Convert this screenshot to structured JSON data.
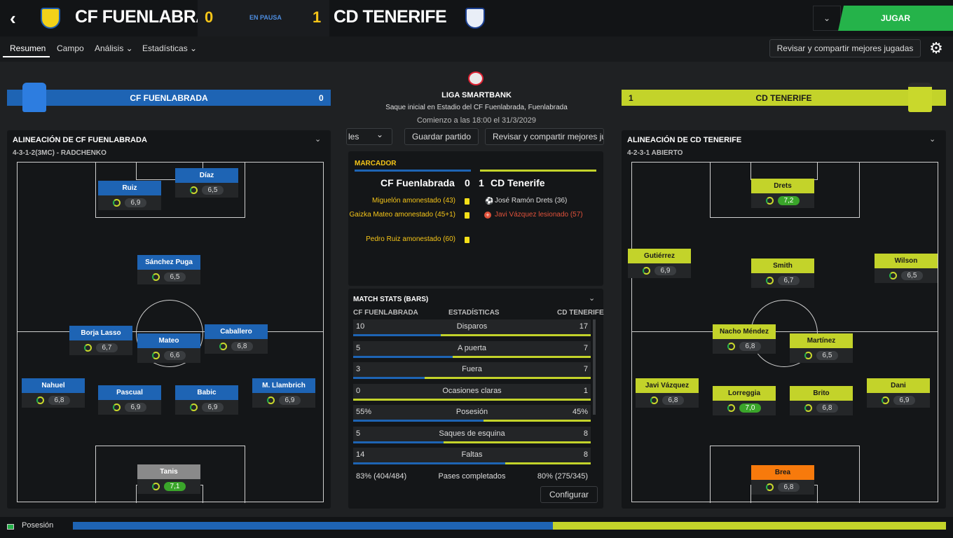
{
  "header": {
    "home_team": "CF FUENLABRADA",
    "away_team": "CD TENERIFE",
    "home_score": "0",
    "away_score": "1",
    "status": "EN PAUSA",
    "play_button": "JUGAR",
    "dropdown_icon": "chevron-down-icon"
  },
  "tabs": [
    {
      "label": "Resumen",
      "active": true
    },
    {
      "label": "Campo"
    },
    {
      "label": "Análisis ⌄"
    },
    {
      "label": "Estadísticas ⌄"
    }
  ],
  "review_button": "Revisar y compartir mejores jugadas",
  "home": {
    "banner_name": "CF FUENLABRADA",
    "banner_score": "0",
    "lineup_title": "ALINEACIÓN DE CF FUENLABRADA",
    "formation": "4-3-1-2(3MC) - RADCHENKO",
    "players": [
      {
        "name": "Díaz",
        "rating": "6,5"
      },
      {
        "name": "Ruiz",
        "rating": "6,9"
      },
      {
        "name": "Sánchez Puga",
        "rating": "6,5"
      },
      {
        "name": "Borja Lasso",
        "rating": "6,7"
      },
      {
        "name": "Mateo",
        "rating": "6,6"
      },
      {
        "name": "Caballero",
        "rating": "6,8"
      },
      {
        "name": "Nahuel",
        "rating": "6,8"
      },
      {
        "name": "Pascual",
        "rating": "6,9"
      },
      {
        "name": "Babic",
        "rating": "6,9"
      },
      {
        "name": "M. Llambrich",
        "rating": "6,9"
      },
      {
        "name": "Tanis",
        "rating": "7,1"
      }
    ]
  },
  "away": {
    "banner_name": "CD TENERIFE",
    "banner_score": "1",
    "lineup_title": "ALINEACIÓN DE CD TENERIFE",
    "formation": "4-2-3-1 ABIERTO",
    "players": [
      {
        "name": "Drets",
        "rating": "7,2"
      },
      {
        "name": "Gutiérrez",
        "rating": "6,9"
      },
      {
        "name": "Smith",
        "rating": "6,7"
      },
      {
        "name": "Wilson",
        "rating": "6,5"
      },
      {
        "name": "Nacho Méndez",
        "rating": "6,8"
      },
      {
        "name": "Martínez",
        "rating": "6,5"
      },
      {
        "name": "Javi Vázquez",
        "rating": "6,8"
      },
      {
        "name": "Lorreggia",
        "rating": "7,0"
      },
      {
        "name": "Brito",
        "rating": "6,8"
      },
      {
        "name": "Dani",
        "rating": "6,9"
      },
      {
        "name": "Brea",
        "rating": "6,8"
      }
    ]
  },
  "match": {
    "league": "LIGA SMARTBANK",
    "kickoff": "Saque inicial en Estadio del CF Fuenlabrada, Fuenlabrada",
    "start_time": "Comienzo a las 18:00 el 31/3/2029",
    "select_label": "les",
    "save_button": "Guardar partido",
    "review_button": "Revisar y compartir mejores ju"
  },
  "scoreboard": {
    "title": "MARCADOR",
    "line": "CF Fuenlabrada  0   1  CD Tenerife",
    "home_events": [
      "Miguelón amonestado (43)",
      "Gaizka Mateo amonestado (45+1)",
      "Pedro Ruiz amonestado (60)"
    ],
    "away_events": [
      {
        "text": "José Ramón Drets (36)",
        "icon": "ball-icon",
        "color": "#dddddd"
      },
      {
        "text": "Javi Vázquez lesionado (57)",
        "icon": "injury-icon",
        "color": "#e0513a"
      }
    ]
  },
  "stats": {
    "title": "MATCH STATS (BARS)",
    "col_home": "CF FUENLABRADA",
    "col_mid": "ESTADÍSTICAS",
    "col_away": "CD TENERIFE",
    "rows": [
      {
        "home": "10",
        "label": "Disparos",
        "away": "17",
        "share": 0.37
      },
      {
        "home": "5",
        "label": "A puerta",
        "away": "7",
        "share": 0.42
      },
      {
        "home": "3",
        "label": "Fuera",
        "away": "7",
        "share": 0.3
      },
      {
        "home": "0",
        "label": "Ocasiones claras",
        "away": "1",
        "share": 0.0
      },
      {
        "home": "55%",
        "label": "Posesión",
        "away": "45%",
        "share": 0.55
      },
      {
        "home": "5",
        "label": "Saques de esquina",
        "away": "8",
        "share": 0.38
      },
      {
        "home": "14",
        "label": "Faltas",
        "away": "8",
        "share": 0.64
      },
      {
        "home": "83% (404/484)",
        "label": "Pases completados",
        "away": "80% (275/345)",
        "share": null
      }
    ],
    "configure_button": "Configurar"
  },
  "possession": {
    "label": "Posesión",
    "home_share": 0.55
  },
  "colors": {
    "home": "#1e64b4",
    "away": "#c3d32a",
    "play": "#25b34a",
    "score": "#f5c518"
  }
}
